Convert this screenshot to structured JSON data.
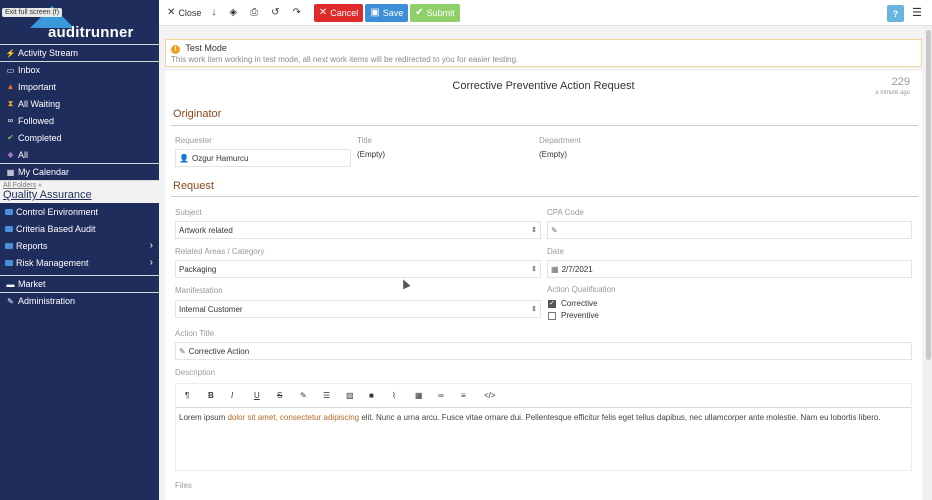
{
  "app": {
    "logo_text": "auditrunner",
    "exit_fullscreen": "Exit full screen (f)"
  },
  "sidebar": {
    "items_top": [
      {
        "label": "Activity Stream",
        "icon": "bolt-icon"
      },
      {
        "label": "Inbox",
        "icon": "inbox-icon"
      },
      {
        "label": "Important",
        "icon": "warning-icon"
      },
      {
        "label": "All Waiting",
        "icon": "hourglass-icon"
      },
      {
        "label": "Followed",
        "icon": "binoculars-icon"
      },
      {
        "label": "Completed",
        "icon": "check-icon"
      },
      {
        "label": "All",
        "icon": "tag-icon"
      },
      {
        "label": "My Calendar",
        "icon": "calendar-icon"
      }
    ],
    "breadcrumb_root": "All Folders",
    "breadcrumb_sep": "»",
    "current_folder": "Quality Assurance",
    "folders": [
      {
        "label": "Control Environment",
        "has_children": false
      },
      {
        "label": "Criteria Based Audit",
        "has_children": false
      },
      {
        "label": "Reports",
        "has_children": true
      },
      {
        "label": "Risk Management",
        "has_children": true
      }
    ],
    "market": "Market",
    "administration": "Administration"
  },
  "toolbar": {
    "close": "Close",
    "cancel": "Cancel",
    "save": "Save",
    "submit": "Submit",
    "help": "?"
  },
  "test_mode": {
    "title": "Test Mode",
    "message": "This work item working in test mode, all next work items will be redirected to you for easier testing."
  },
  "form": {
    "title": "Corrective Preventive Action Request",
    "number": "229",
    "time": "a minute ago",
    "originator": {
      "heading": "Originator",
      "requester_label": "Requester",
      "requester_value": "Ozgur Hamurcu",
      "title_label": "Title",
      "title_value": "(Empty)",
      "department_label": "Department",
      "department_value": "(Empty)"
    },
    "request": {
      "heading": "Request",
      "subject_label": "Subject",
      "subject_value": "Artwork related",
      "cpa_label": "CPA Code",
      "areas_label": "Related Areas / Category",
      "areas_value": "Packaging",
      "date_label": "Date",
      "date_value": "2/7/2021",
      "manifestation_label": "Manifestation",
      "manifestation_value": "Internal Customer",
      "qualification_label": "Action Qualification",
      "corrective_label": "Corrective",
      "preventive_label": "Preventive",
      "action_title_label": "Action Title",
      "action_title_value": "Corrective Action",
      "description_label": "Description",
      "description_part1": "Lorem ipsum ",
      "description_part2": "dolor sit amet, consectetur adipiscing",
      "description_part3": " elit. Nunc a urna arcu. Fusce vitae ornare dui. Pellentesque efficitur felis eget tellus dapibus, nec ullamcorper ante molestie. Nam eu lobortis libero.",
      "files_label": "Files"
    }
  }
}
